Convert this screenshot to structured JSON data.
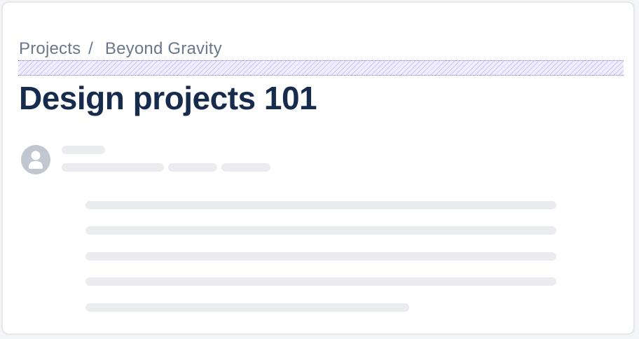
{
  "breadcrumb": {
    "root": "Projects",
    "separator": "/",
    "current": "Beyond Gravity"
  },
  "page": {
    "title": "Design projects 101"
  },
  "author": {
    "avatar_icon": "user-avatar-icon"
  },
  "colors": {
    "title": "#172b4d",
    "breadcrumb": "#6b778c",
    "skeleton": "#ebecf0",
    "avatar": "#c1c7d0",
    "spacing_highlight": "#8777d9"
  }
}
